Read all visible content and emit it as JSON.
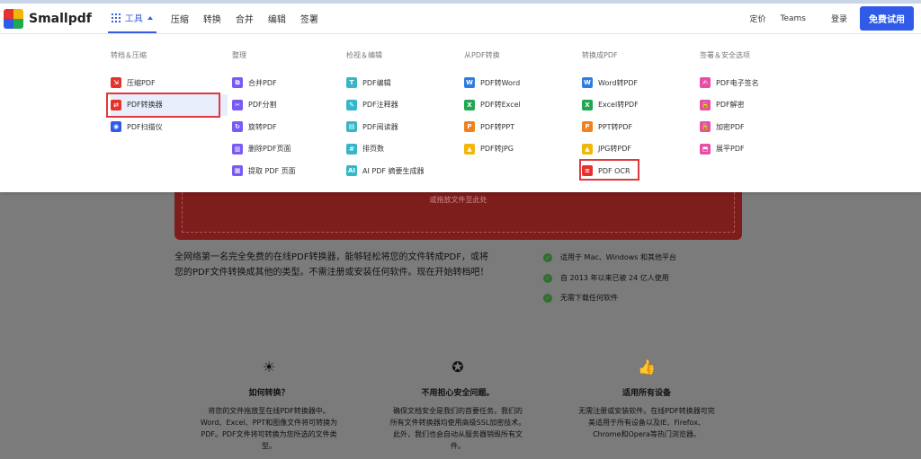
{
  "header": {
    "brand": "Smallpdf",
    "tools_label": "工具",
    "nav": [
      "压缩",
      "转换",
      "合并",
      "编辑",
      "签署"
    ],
    "pricing": "定价",
    "teams": "Teams",
    "login": "登录",
    "trial": "免费试用"
  },
  "menu": {
    "columns": [
      {
        "title": "转档＆压缩",
        "items": [
          {
            "label": "压缩PDF",
            "icon": "compress-icon",
            "color": "#e5322d",
            "glyph": "⇲"
          },
          {
            "label": "PDF转换器",
            "icon": "converter-icon",
            "color": "#e5322d",
            "glyph": "⇄",
            "selected": true
          },
          {
            "label": "PDF扫描仪",
            "icon": "scanner-icon",
            "color": "#2f5be8",
            "glyph": "◉"
          }
        ]
      },
      {
        "title": "整理",
        "items": [
          {
            "label": "合并PDF",
            "icon": "merge-icon",
            "color": "#7a5af5",
            "glyph": "⧉"
          },
          {
            "label": "PDF分割",
            "icon": "split-icon",
            "color": "#7a5af5",
            "glyph": "✂"
          },
          {
            "label": "旋转PDF",
            "icon": "rotate-icon",
            "color": "#7a5af5",
            "glyph": "↻"
          },
          {
            "label": "删除PDF页面",
            "icon": "delete-icon",
            "color": "#7a5af5",
            "glyph": "▥"
          },
          {
            "label": "提取 PDF 页面",
            "icon": "extract-icon",
            "color": "#7a5af5",
            "glyph": "▦"
          }
        ]
      },
      {
        "title": "检视＆编辑",
        "items": [
          {
            "label": "PDF编辑",
            "icon": "edit-icon",
            "color": "#35b7c9",
            "glyph": "T"
          },
          {
            "label": "PDF注释器",
            "icon": "annotate-icon",
            "color": "#35b7c9",
            "glyph": "✎"
          },
          {
            "label": "PDF阅读器",
            "icon": "reader-icon",
            "color": "#35b7c9",
            "glyph": "▤"
          },
          {
            "label": "排页数",
            "icon": "page-number-icon",
            "color": "#35b7c9",
            "glyph": "#"
          },
          {
            "label": "AI PDF 摘要生成器",
            "icon": "ai-summary-icon",
            "color": "#35b7c9",
            "glyph": "AI"
          }
        ]
      },
      {
        "title": "从PDF转换",
        "items": [
          {
            "label": "PDF转Word",
            "icon": "word-icon",
            "color": "#2f7de1",
            "glyph": "W"
          },
          {
            "label": "PDF转Excel",
            "icon": "excel-icon",
            "color": "#1fa84f",
            "glyph": "X"
          },
          {
            "label": "PDF转PPT",
            "icon": "ppt-icon",
            "color": "#f0821e",
            "glyph": "P"
          },
          {
            "label": "PDF转JPG",
            "icon": "jpg-icon",
            "color": "#f2b705",
            "glyph": "▲"
          }
        ]
      },
      {
        "title": "转换成PDF",
        "items": [
          {
            "label": "Word转PDF",
            "icon": "word-icon",
            "color": "#2f7de1",
            "glyph": "W"
          },
          {
            "label": "Excel转PDF",
            "icon": "excel-icon",
            "color": "#1fa84f",
            "glyph": "X"
          },
          {
            "label": "PPT转PDF",
            "icon": "ppt-icon",
            "color": "#f0821e",
            "glyph": "P"
          },
          {
            "label": "JPG转PDF",
            "icon": "jpg-icon",
            "color": "#f2b705",
            "glyph": "▲"
          },
          {
            "label": "PDF OCR",
            "icon": "ocr-icon",
            "color": "#e5322d",
            "glyph": "≡",
            "highlighted": true
          }
        ]
      },
      {
        "title": "签署＆安全选项",
        "items": [
          {
            "label": "PDF电子签名",
            "icon": "sign-icon",
            "color": "#e84ea6",
            "glyph": "✍"
          },
          {
            "label": "PDF解密",
            "icon": "unlock-icon",
            "color": "#e84ea6",
            "glyph": "🔓"
          },
          {
            "label": "加密PDF",
            "icon": "lock-icon",
            "color": "#e84ea6",
            "glyph": "🔒"
          },
          {
            "label": "展平PDF",
            "icon": "flatten-icon",
            "color": "#e84ea6",
            "glyph": "⬒"
          }
        ]
      }
    ]
  },
  "drop_text": "或拖放文件至此处",
  "intro_line1": "全网络第一名完全免费的在线PDF转换器，能够轻松将您的文件转成PDF，或将",
  "intro_line2": "您的PDF文件转换成其他的类型。不需注册或安装任何软件。现在开始转档吧！",
  "features": [
    "适用于 Mac、Windows 和其他平台",
    "自 2013 年以来已被 24 亿人使用",
    "无需下载任何软件"
  ],
  "cards": [
    {
      "title": "如何转换？",
      "icon": "lightbulb-icon",
      "glyph": "☀",
      "lines": [
        "将您的文件拖放至在线PDF转换器中。",
        "Word、Excel、PPT和图像文件将可转换为",
        "PDF。PDF文件将可转换为您所选的文件类",
        "型。"
      ]
    },
    {
      "title": "不用担心安全问题。",
      "icon": "badge-icon",
      "glyph": "✪",
      "lines": [
        "确保文档安全是我们的首要任务。我们的",
        "所有文件转换器均使用高级SSL加密技术。",
        "此外，我们也会自动从服务器销毁所有文",
        "件。"
      ]
    },
    {
      "title": "适用所有设备",
      "icon": "thumbs-up-icon",
      "glyph": "👍",
      "lines": [
        "无需注册或安装软件。在线PDF转换器可完",
        "美适用于所有设备以及IE、Firefox、",
        "Chrome和Opera等热门浏览器。"
      ]
    }
  ]
}
